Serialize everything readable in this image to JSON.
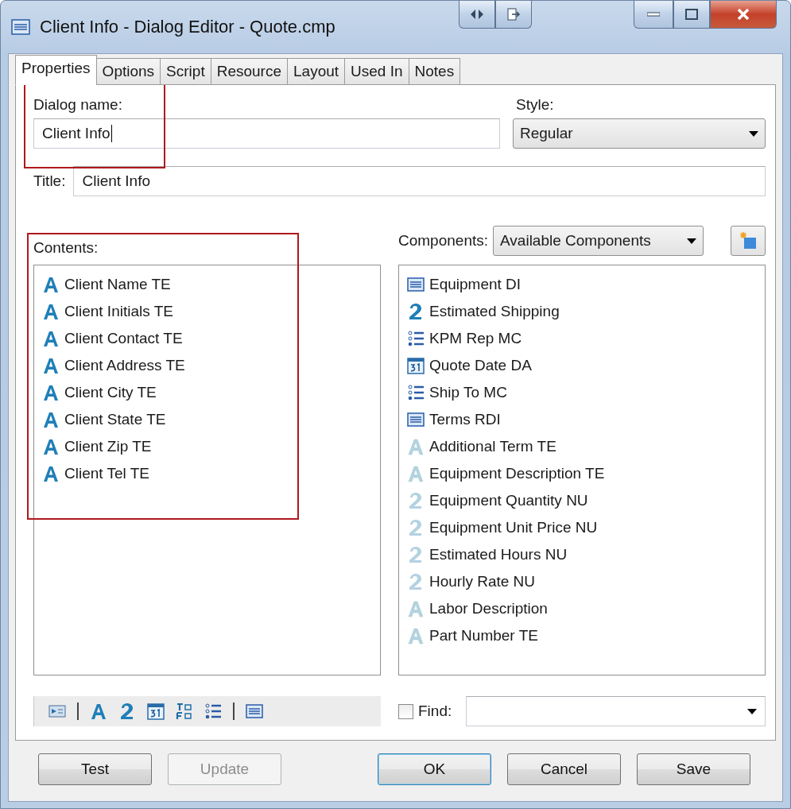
{
  "window": {
    "title": "Client Info - Dialog Editor - Quote.cmp"
  },
  "tabs": [
    {
      "label": "Properties",
      "selected": true
    },
    {
      "label": "Options",
      "selected": false
    },
    {
      "label": "Script",
      "selected": false
    },
    {
      "label": "Resource",
      "selected": false
    },
    {
      "label": "Layout",
      "selected": false
    },
    {
      "label": "Used In",
      "selected": false
    },
    {
      "label": "Notes",
      "selected": false
    }
  ],
  "dialog_name": {
    "label": "Dialog name:",
    "value": "Client Info",
    "highlighted": true
  },
  "style": {
    "label": "Style:",
    "value": "Regular"
  },
  "title_field": {
    "label": "Title:",
    "value": "Client Info"
  },
  "contents": {
    "label": "Contents:",
    "highlighted": true,
    "items": [
      {
        "kind": "text",
        "label": "Client Name TE"
      },
      {
        "kind": "text",
        "label": "Client Initials TE"
      },
      {
        "kind": "text",
        "label": "Client Contact TE"
      },
      {
        "kind": "text",
        "label": "Client Address TE"
      },
      {
        "kind": "text",
        "label": "Client City TE"
      },
      {
        "kind": "text",
        "label": "Client State TE"
      },
      {
        "kind": "text",
        "label": "Client Zip TE"
      },
      {
        "kind": "text",
        "label": "Client Tel TE"
      }
    ]
  },
  "components": {
    "label": "Components:",
    "filter": "Available Components",
    "items": [
      {
        "kind": "dropdown",
        "label": "Equipment DI",
        "dimmed": false
      },
      {
        "kind": "number",
        "label": "Estimated Shipping",
        "dimmed": false
      },
      {
        "kind": "choice",
        "label": "KPM Rep MC",
        "dimmed": false
      },
      {
        "kind": "date",
        "label": "Quote Date DA",
        "dimmed": false
      },
      {
        "kind": "choice",
        "label": "Ship To MC",
        "dimmed": false
      },
      {
        "kind": "dropdown",
        "label": "Terms RDI",
        "dimmed": false
      },
      {
        "kind": "text",
        "label": "Additional Term TE",
        "dimmed": true
      },
      {
        "kind": "text",
        "label": "Equipment Description TE",
        "dimmed": true
      },
      {
        "kind": "number",
        "label": "Equipment Quantity NU",
        "dimmed": true
      },
      {
        "kind": "number",
        "label": "Equipment Unit Price NU",
        "dimmed": true
      },
      {
        "kind": "number",
        "label": "Estimated Hours NU",
        "dimmed": true
      },
      {
        "kind": "number",
        "label": "Hourly Rate NU",
        "dimmed": true
      },
      {
        "kind": "text",
        "label": "Labor Description",
        "dimmed": true
      },
      {
        "kind": "text",
        "label": "Part Number TE",
        "dimmed": true
      }
    ]
  },
  "toolbar": [
    {
      "kind": "insert"
    },
    {
      "kind": "separator"
    },
    {
      "kind": "text"
    },
    {
      "kind": "number"
    },
    {
      "kind": "date"
    },
    {
      "kind": "form"
    },
    {
      "kind": "choice"
    },
    {
      "kind": "separator"
    },
    {
      "kind": "dropdown"
    }
  ],
  "find": {
    "label": "Find:",
    "checked": false
  },
  "buttons": [
    {
      "label": "Test",
      "disabled": false,
      "default": false
    },
    {
      "label": "Update",
      "disabled": true,
      "default": false
    },
    {
      "label": "OK",
      "disabled": false,
      "default": true
    },
    {
      "label": "Cancel",
      "disabled": false,
      "default": false
    },
    {
      "label": "Save",
      "disabled": false,
      "default": false
    }
  ]
}
